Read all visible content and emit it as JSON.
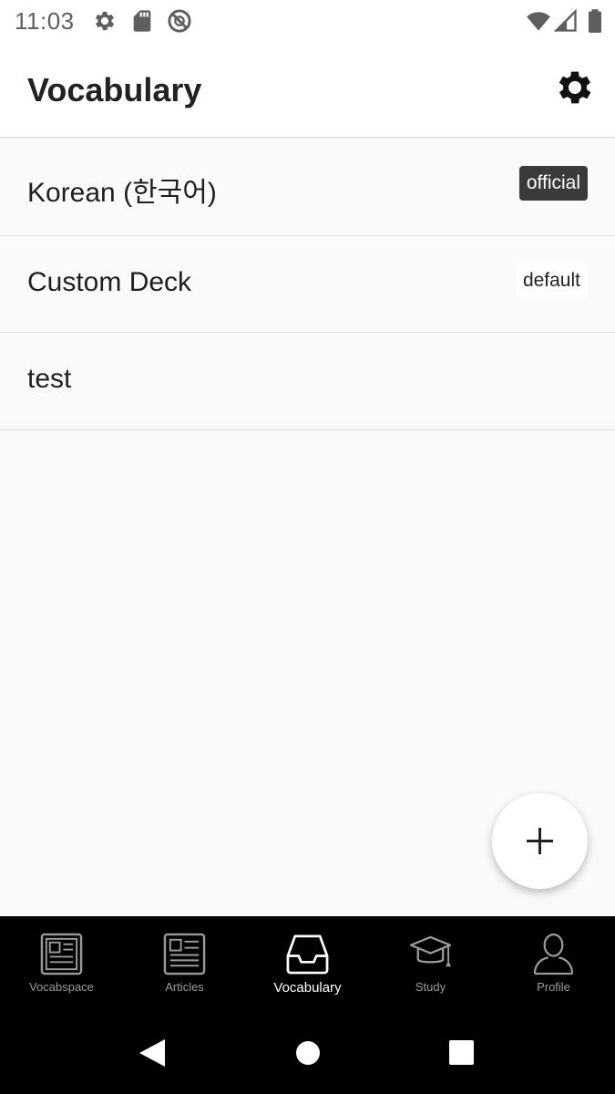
{
  "status_bar": {
    "time": "11:03",
    "left_icons": [
      "gear-icon",
      "sd-card-icon",
      "do-not-disturb-icon"
    ],
    "right_icons": [
      "wifi-icon",
      "cell-signal-icon",
      "battery-icon"
    ]
  },
  "app_bar": {
    "title": "Vocabulary",
    "settings_icon": "gear-icon"
  },
  "decks": [
    {
      "name": "Korean (한국어)",
      "badge": "official",
      "badge_style": "dark"
    },
    {
      "name": "Custom Deck",
      "badge": "default",
      "badge_style": "light"
    },
    {
      "name": "test",
      "badge": ""
    }
  ],
  "fab": {
    "icon": "plus-icon"
  },
  "bottom_nav": {
    "active": "Vocabulary",
    "items": [
      {
        "label": "Vocabspace",
        "icon": "newspaper-icon"
      },
      {
        "label": "Articles",
        "icon": "article-icon"
      },
      {
        "label": "Vocabulary",
        "icon": "inbox-icon"
      },
      {
        "label": "Study",
        "icon": "graduation-cap-icon"
      },
      {
        "label": "Profile",
        "icon": "person-icon"
      }
    ]
  },
  "system_nav": {
    "buttons": [
      "back-icon",
      "home-icon",
      "recents-icon"
    ]
  },
  "colors": {
    "background": "#fafafa",
    "app_bar": "#ffffff",
    "nav_background": "#000000",
    "nav_active": "#ffffff",
    "nav_inactive": "#9a9a9a",
    "badge_dark": "#3a3a3a"
  }
}
